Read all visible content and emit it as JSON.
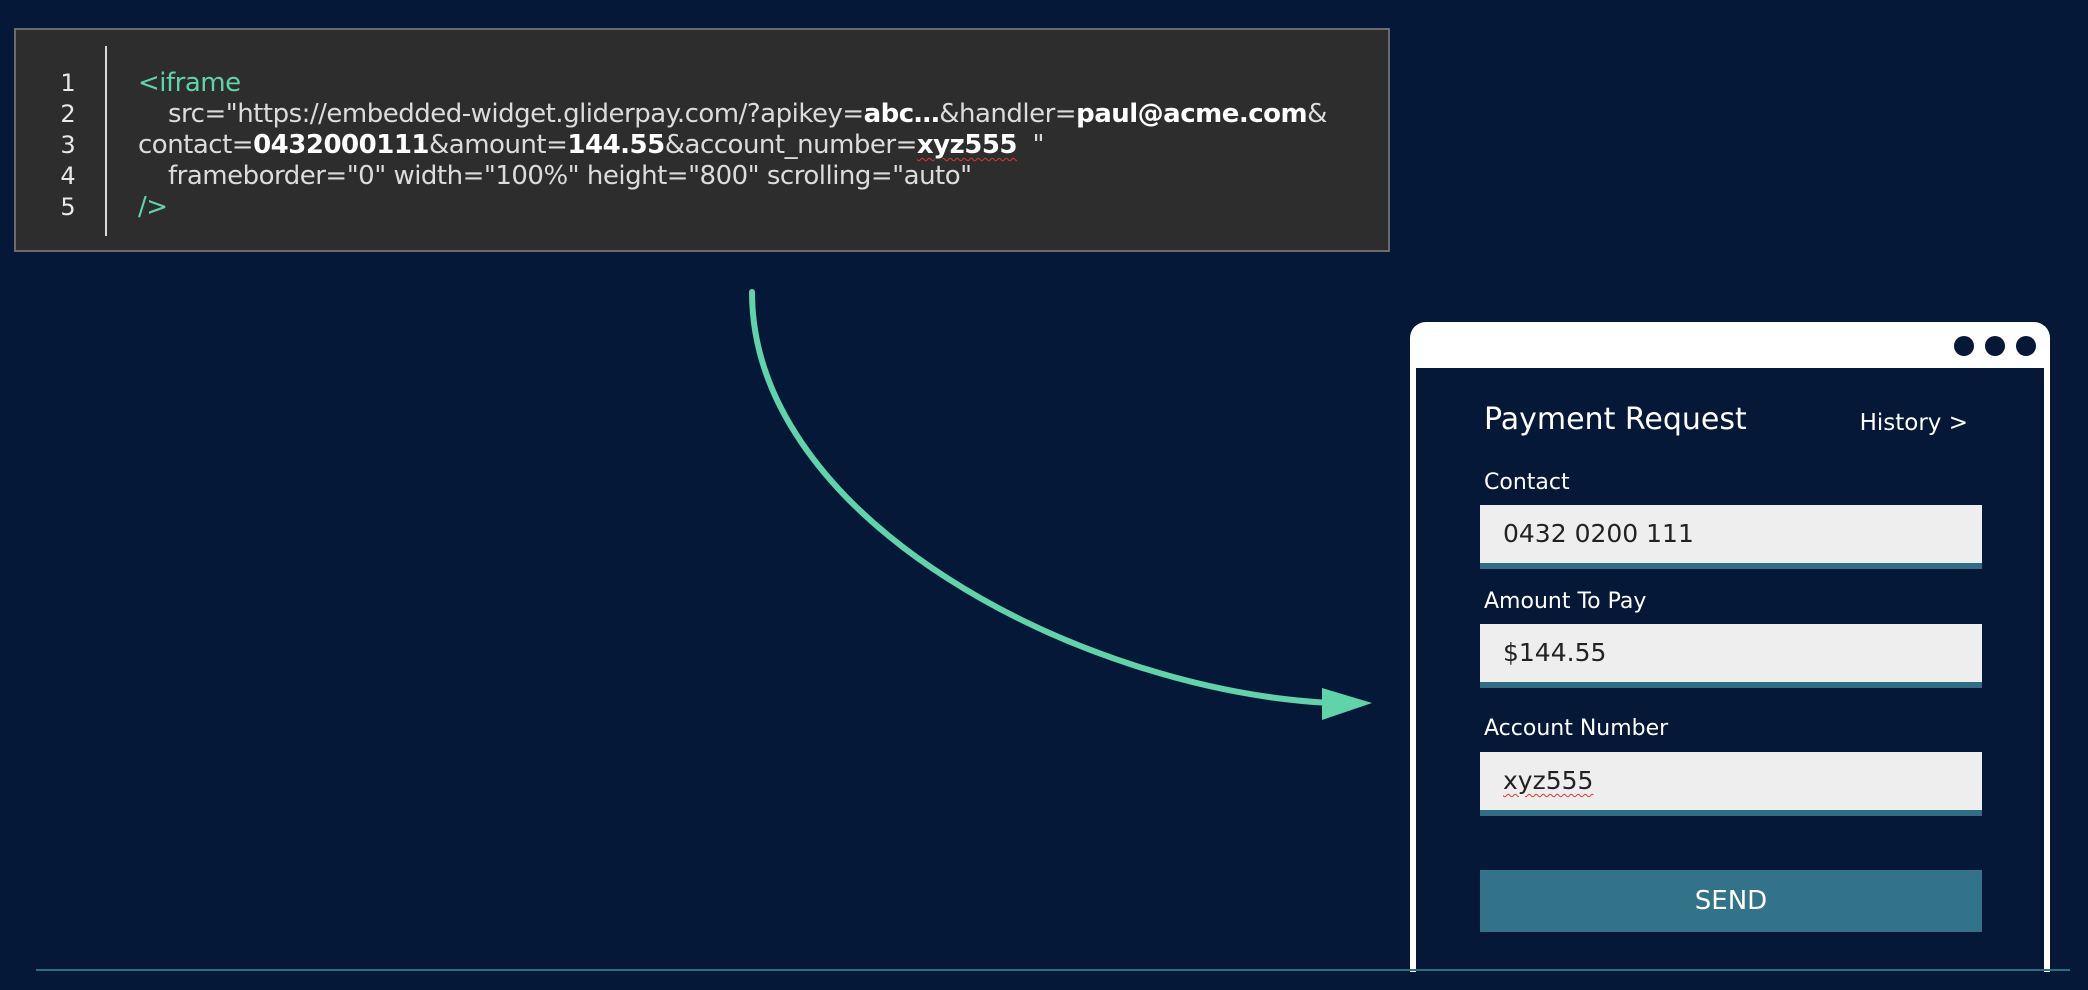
{
  "code_panel": {
    "line_numbers": [
      "1",
      "2",
      "3",
      "4",
      "5"
    ],
    "line1": {
      "tag": "<iframe"
    },
    "line2": {
      "t1": "src=\"https://embedded-widget.gliderpay.com/?apikey=",
      "b1": "abc…",
      "t2": "&handler=",
      "b2": "paul@acme.com",
      "t3": "&"
    },
    "line3": {
      "t1": "contact=",
      "b1": "0432000111",
      "t2": "&amount=",
      "b2": "144.55",
      "t3": "&account_number=",
      "b3": "xyz555",
      "t4": "  \""
    },
    "line4": {
      "text": "frameborder=\"0\" width=\"100%\" height=\"800\" scrolling=\"auto\""
    },
    "line5": {
      "tag": "/>"
    }
  },
  "colors": {
    "background": "#061838",
    "accent_green": "#5fd4a8",
    "field_underline": "#2f6e84",
    "button": "#33738a"
  },
  "widget": {
    "window_controls": [
      "dot-icon",
      "dot-icon",
      "dot-icon"
    ],
    "title": "Payment Request",
    "history_link": "History >",
    "fields": [
      {
        "label": "Contact",
        "value": "0432 0200 111"
      },
      {
        "label": "Amount To Pay",
        "value": "$144.55"
      },
      {
        "label": "Account Number",
        "value": "xyz555"
      }
    ],
    "send_button": "SEND"
  }
}
